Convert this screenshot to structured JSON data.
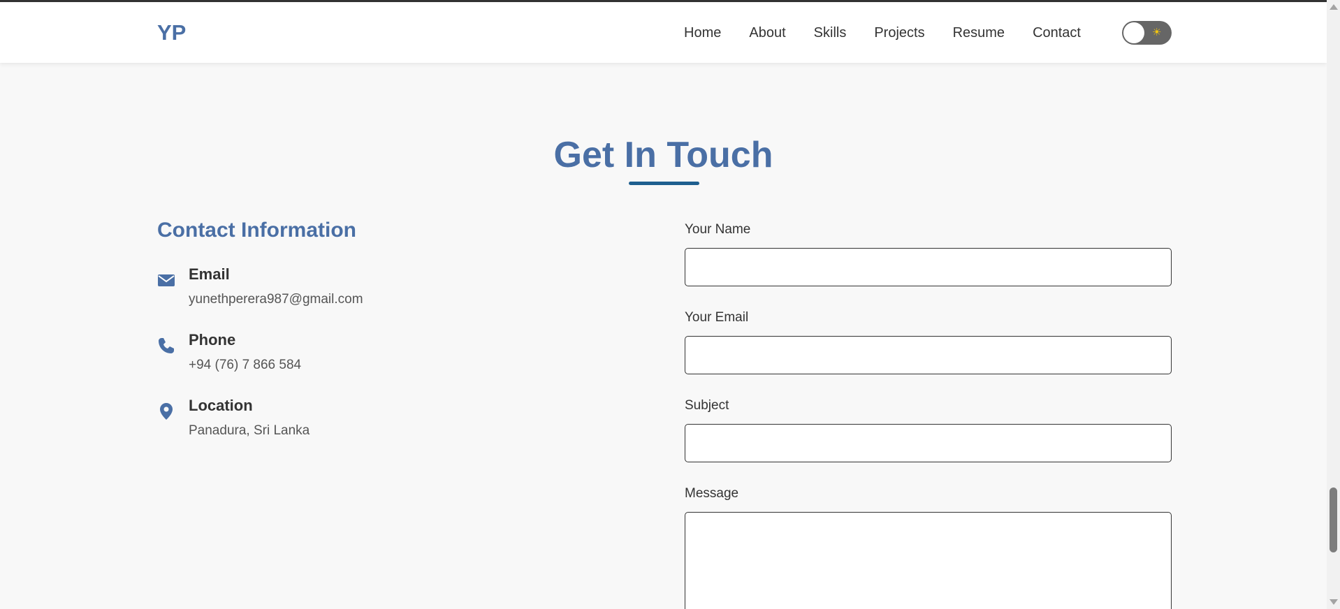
{
  "nav": {
    "logo": "YP",
    "links": [
      "Home",
      "About",
      "Skills",
      "Projects",
      "Resume",
      "Contact"
    ],
    "theme_toggle_icon": "sun-icon"
  },
  "section": {
    "title": "Get In Touch"
  },
  "contact_info": {
    "heading": "Contact Information",
    "items": [
      {
        "icon": "envelope-icon",
        "title": "Email",
        "value": "yunethperera987@gmail.com"
      },
      {
        "icon": "phone-icon",
        "title": "Phone",
        "value": "+94 (76) 7 866 584"
      },
      {
        "icon": "location-pin-icon",
        "title": "Location",
        "value": "Panadura, Sri Lanka"
      }
    ]
  },
  "form": {
    "name_label": "Your Name",
    "name_value": "",
    "email_label": "Your Email",
    "email_value": "",
    "subject_label": "Subject",
    "subject_value": "",
    "message_label": "Message",
    "message_value": ""
  },
  "colors": {
    "accent": "#4a6fa5",
    "underline": "#1e5f8f",
    "background": "#f8f8f8",
    "toggle": "#666666"
  }
}
